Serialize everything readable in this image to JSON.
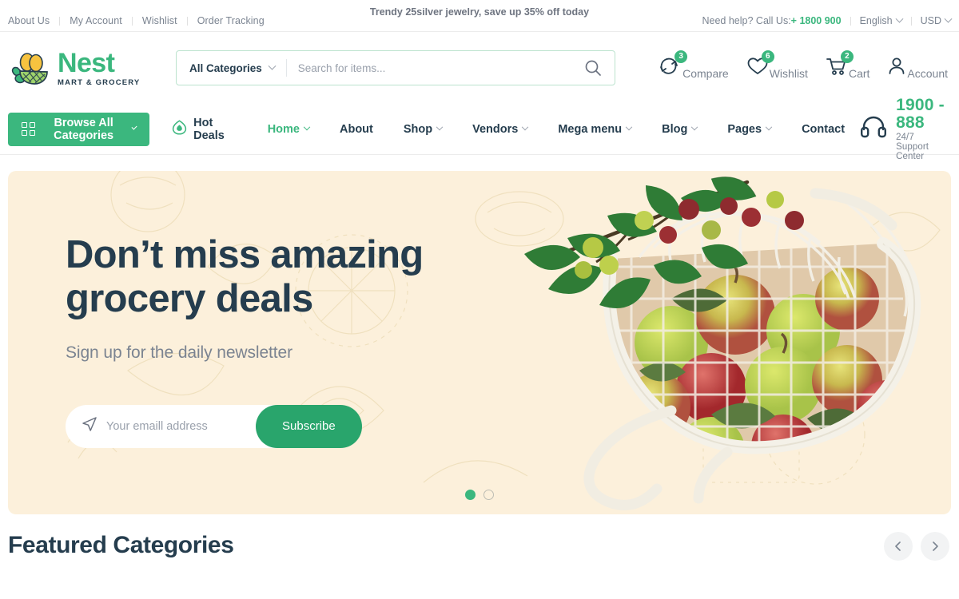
{
  "topbar": {
    "links": [
      "About Us",
      "My Account",
      "Wishlist",
      "Order Tracking"
    ],
    "ticker": "Trendy 25silver jewelry, save up 35% off today",
    "need_help_label": "Need help? Call Us:",
    "phone": "+ 1800 900",
    "language": "English",
    "currency": "USD"
  },
  "header": {
    "brand": "Nest",
    "tagline": "MART & GROCERY",
    "search": {
      "category": "All Categories",
      "placeholder": "Search for items...",
      "value": ""
    },
    "actions": [
      {
        "label": "Compare",
        "count": "3",
        "icon": "compare-icon"
      },
      {
        "label": "Wishlist",
        "count": "6",
        "icon": "heart-icon"
      },
      {
        "label": "Cart",
        "count": "2",
        "icon": "cart-icon"
      },
      {
        "label": "Account",
        "count": "",
        "icon": "user-icon"
      }
    ]
  },
  "nav": {
    "browse_label": "Browse All Categories",
    "hot_deals": "Hot Deals",
    "menu": [
      {
        "label": "Home",
        "caret": true,
        "active": true
      },
      {
        "label": "About",
        "caret": false,
        "active": false
      },
      {
        "label": "Shop",
        "caret": true,
        "active": false
      },
      {
        "label": "Vendors",
        "caret": true,
        "active": false
      },
      {
        "label": "Mega menu",
        "caret": true,
        "active": false
      },
      {
        "label": "Blog",
        "caret": true,
        "active": false
      },
      {
        "label": "Pages",
        "caret": true,
        "active": false
      },
      {
        "label": "Contact",
        "caret": false,
        "active": false
      }
    ],
    "support_phone": "1900 - 888",
    "support_sub": "24/7 Support Center"
  },
  "hero": {
    "heading_line1": "Don’t miss amazing",
    "heading_line2": "grocery deals",
    "subheading": "Sign up for the daily newsletter",
    "email_placeholder": "Your emaill address",
    "email_value": "",
    "subscribe_label": "Subscribe",
    "slides": 2,
    "active_slide": 0
  },
  "below": {
    "section_title": "Featured Categories"
  },
  "colors": {
    "brand_green": "#3BB77E",
    "subscribe_green": "#29A56C",
    "dark_navy": "#253D4E",
    "muted_grey": "#7b8491",
    "hero_cream": "#FCF0DB"
  }
}
